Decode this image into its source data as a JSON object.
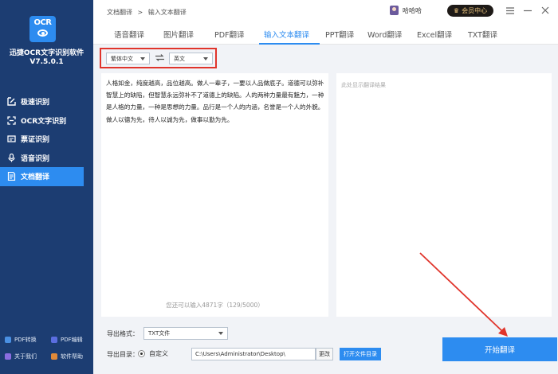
{
  "app": {
    "logo": "OCR",
    "name": "迅捷OCR文字识别软件",
    "version": "V7.5.0.1"
  },
  "sidebar": {
    "items": [
      {
        "label": "极速识别",
        "icon": "quick-scan-icon"
      },
      {
        "label": "OCR文字识别",
        "icon": "ocr-scan-icon"
      },
      {
        "label": "票证识别",
        "icon": "ticket-icon"
      },
      {
        "label": "语音识别",
        "icon": "microphone-icon"
      },
      {
        "label": "文档翻译",
        "icon": "document-translate-icon"
      }
    ],
    "bottom_links": [
      {
        "label": "PDF转换",
        "color": "#4a90e2"
      },
      {
        "label": "PDF编辑",
        "color": "#5b6ee0"
      },
      {
        "label": "关于我们",
        "color": "#8a6de0"
      },
      {
        "label": "软件帮助",
        "color": "#e08a3a"
      }
    ]
  },
  "topbar": {
    "breadcrumb_parent": "文档翻译",
    "breadcrumb_sep": ">",
    "breadcrumb_current": "输入文本翻译",
    "username": "哈哈哈",
    "vip_label": "会员中心"
  },
  "tabs": [
    {
      "label": "语音翻译"
    },
    {
      "label": "图片翻译"
    },
    {
      "label": "PDF翻译"
    },
    {
      "label": "输入文本翻译"
    },
    {
      "label": "PPT翻译"
    },
    {
      "label": "Word翻译"
    },
    {
      "label": "Excel翻译"
    },
    {
      "label": "TXT翻译"
    }
  ],
  "translate": {
    "source_lang": "繁体中文",
    "target_lang": "英文",
    "source_text": "人格如金，纯度越高，品位越高。做人一辈子，一要以人品做底子。道德可以弥补智慧上的缺陷，但智慧永远弥补不了道德上的缺陷。人的两种力量最有魅力，一种是人格的力量，一种是思想的力量。品行是一个人的内涵，名誉是一个人的外貌。做人以德为先，待人以诚为先，做事以勤为先。",
    "counter": "您还可以输入4871字（129/5000）",
    "target_placeholder": "此处显示翻译结果"
  },
  "export": {
    "format_label": "导出格式：",
    "format_value": "TXT文件",
    "dir_label": "导出目录：",
    "custom_label": "自定义",
    "path": "C:\\Users\\Administrator\\Desktop\\",
    "change_label": "更改",
    "open_folder_label": "打开文件目录"
  },
  "start_label": "开始翻译",
  "colors": {
    "sidebar_bg": "#1c3d72",
    "accent": "#2d8cf0",
    "highlight": "#e0342b"
  }
}
